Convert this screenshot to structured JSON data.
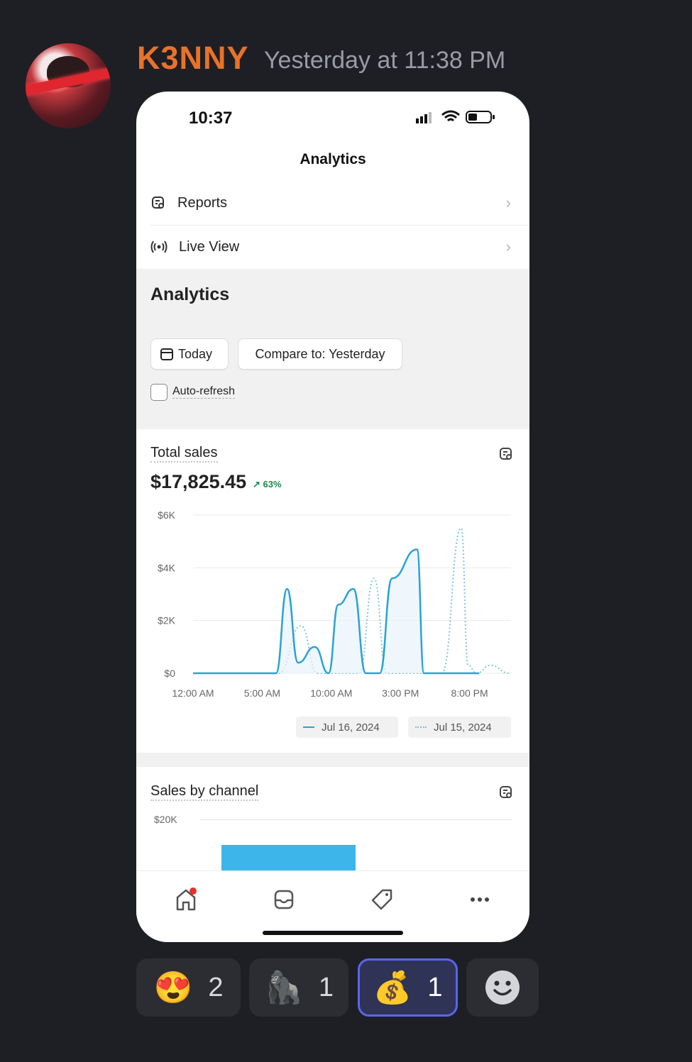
{
  "message": {
    "username": "K3NNY",
    "timestamp": "Yesterday at 11:38 PM",
    "avatar": "avatar"
  },
  "phone": {
    "status_time": "10:37",
    "nav_title": "Analytics",
    "menu": [
      {
        "label": "Reports",
        "icon": "reports-icon"
      },
      {
        "label": "Live View",
        "icon": "live-view-icon"
      }
    ],
    "section_title": "Analytics",
    "date_chip": "Today",
    "compare_chip": "Compare to: Yesterday",
    "auto_refresh_label": "Auto-refresh",
    "total_sales": {
      "title": "Total sales",
      "value": "$17,825.45",
      "delta": "63%",
      "delta_color": "#1d8a4e"
    },
    "sales_by_channel": {
      "title": "Sales by channel",
      "tick": "$20K"
    },
    "legend": [
      {
        "label": "Jul 16, 2024",
        "style": "solid"
      },
      {
        "label": "Jul 15, 2024",
        "style": "dotted"
      }
    ],
    "tabs": [
      "home-icon",
      "orders-icon",
      "products-icon",
      "more-icon"
    ]
  },
  "chart_data": {
    "type": "line",
    "title": "",
    "xlabel": "",
    "ylabel": "",
    "x_ticks": [
      "12:00 AM",
      "5:00 AM",
      "10:00 AM",
      "3:00 PM",
      "8:00 PM"
    ],
    "y_ticks": [
      "$0",
      "$2K",
      "$4K",
      "$6K"
    ],
    "ylim": [
      0,
      6000
    ],
    "x_unit": "hour",
    "xlim": [
      0,
      23
    ],
    "grid": true,
    "legend_position": "bottom-right",
    "series": [
      {
        "name": "Jul 16, 2024",
        "style": "solid",
        "color": "#29a3d6",
        "points": [
          [
            0,
            0
          ],
          [
            6,
            0
          ],
          [
            6.8,
            3200
          ],
          [
            7.6,
            400
          ],
          [
            8.8,
            1000
          ],
          [
            9.8,
            0
          ],
          [
            10.5,
            2600
          ],
          [
            11.6,
            3200
          ],
          [
            12.5,
            0
          ],
          [
            13.5,
            0
          ],
          [
            14.4,
            3600
          ],
          [
            16.2,
            4700
          ],
          [
            16.7,
            0
          ],
          [
            20.7,
            0
          ]
        ]
      },
      {
        "name": "Jul 15, 2024",
        "style": "dotted",
        "color": "#7fc3df",
        "points": [
          [
            6.2,
            0
          ],
          [
            7.8,
            1800
          ],
          [
            9,
            0
          ],
          [
            12,
            0
          ],
          [
            13.1,
            3600
          ],
          [
            14,
            0
          ],
          [
            18,
            0
          ],
          [
            19.4,
            5500
          ],
          [
            19.9,
            300
          ],
          [
            20.5,
            0
          ],
          [
            21.5,
            300
          ],
          [
            22.9,
            0
          ]
        ]
      }
    ]
  },
  "reactions": [
    {
      "emoji": "😍",
      "count": "2",
      "active": false
    },
    {
      "emoji": "🦍",
      "count": "1",
      "active": false
    },
    {
      "emoji": "💰",
      "count": "1",
      "active": true
    },
    {
      "emoji": "add-reaction-icon",
      "count": "",
      "active": false
    }
  ]
}
